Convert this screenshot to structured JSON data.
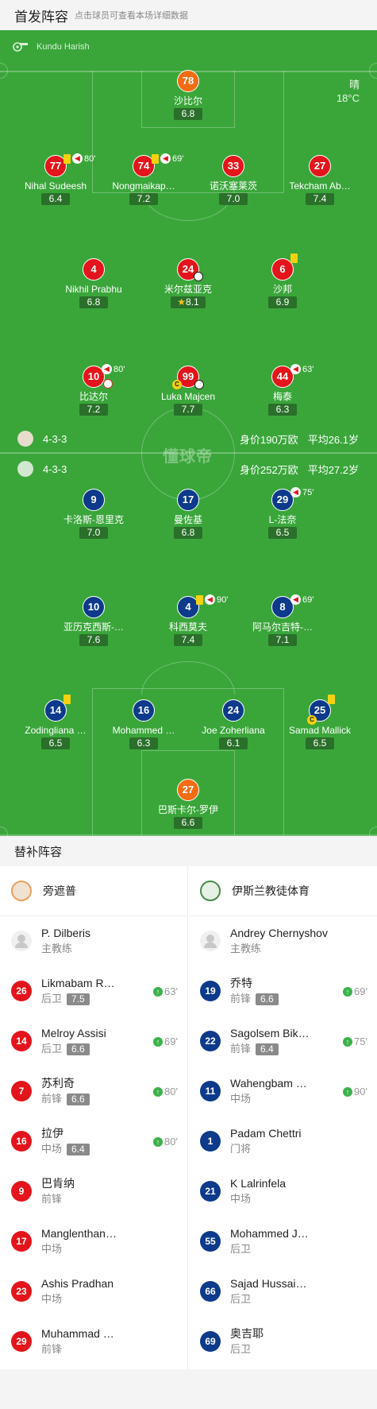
{
  "header": {
    "title": "首发阵容",
    "subtitle": "点击球员可查看本场详细数据"
  },
  "referee": {
    "name": "Kundu Harish",
    "icon": "whistle-icon"
  },
  "weather": {
    "condition": "晴",
    "temperature": "18°C"
  },
  "watermark": "懂球帝",
  "home_team": {
    "formation": "4-3-3",
    "value": "身价190万欧",
    "avg_age": "平均26.1岁"
  },
  "away_team": {
    "formation": "4-3-3",
    "value": "身价252万欧",
    "avg_age": "平均27.2岁"
  },
  "home_players": [
    {
      "num": "78",
      "name": "沙比尔",
      "rating": "6.8"
    },
    {
      "num": "77",
      "name": "Nihal Sudeesh",
      "rating": "6.4",
      "min": "80'"
    },
    {
      "num": "74",
      "name": "Nongmaikap…",
      "rating": "7.2",
      "min": "69'"
    },
    {
      "num": "33",
      "name": "诺沃塞莱茨",
      "rating": "7.0"
    },
    {
      "num": "27",
      "name": "Tekcham Ab…",
      "rating": "7.4"
    },
    {
      "num": "4",
      "name": "Nikhil Prabhu",
      "rating": "6.8"
    },
    {
      "num": "24",
      "name": "米尔兹亚克",
      "rating": "8.1"
    },
    {
      "num": "6",
      "name": "沙邦",
      "rating": "6.9"
    },
    {
      "num": "10",
      "name": "比达尔",
      "rating": "7.2",
      "min": "80'"
    },
    {
      "num": "99",
      "name": "Luka Majcen",
      "rating": "7.7"
    },
    {
      "num": "44",
      "name": "梅泰",
      "rating": "6.3",
      "min": "63'"
    }
  ],
  "away_players": [
    {
      "num": "9",
      "name": "卡洛斯-恩里克",
      "rating": "7.0"
    },
    {
      "num": "17",
      "name": "曼佐基",
      "rating": "6.8"
    },
    {
      "num": "29",
      "name": "L-法奈",
      "rating": "6.5",
      "min": "75'"
    },
    {
      "num": "10",
      "name": "亚历克西斯-…",
      "rating": "7.6"
    },
    {
      "num": "4",
      "name": "科西莫夫",
      "rating": "7.4",
      "min": "90'"
    },
    {
      "num": "8",
      "name": "阿马尔吉特-…",
      "rating": "7.1",
      "min": "69'"
    },
    {
      "num": "14",
      "name": "Zodingliana …",
      "rating": "6.5"
    },
    {
      "num": "16",
      "name": "Mohammed …",
      "rating": "6.3"
    },
    {
      "num": "24",
      "name": "Joe Zoherliana",
      "rating": "6.1"
    },
    {
      "num": "25",
      "name": "Samad Mallick",
      "rating": "6.5"
    },
    {
      "num": "27",
      "name": "巴斯卡尔-罗伊",
      "rating": "6.6"
    }
  ],
  "captain_badge": "C",
  "subs": {
    "title": "替补阵容",
    "home": {
      "team": "旁遮普",
      "coach": {
        "name": "P. Dilberis",
        "role": "主教练"
      },
      "players": [
        {
          "num": "26",
          "name": "Likmabam R…",
          "pos": "后卫",
          "rating": "7.5",
          "min": "63'"
        },
        {
          "num": "14",
          "name": "Melroy Assisi",
          "pos": "后卫",
          "rating": "6.6",
          "min": "69'"
        },
        {
          "num": "7",
          "name": "苏利奇",
          "pos": "前锋",
          "rating": "6.6",
          "min": "80'"
        },
        {
          "num": "16",
          "name": "拉伊",
          "pos": "中场",
          "rating": "6.4",
          "min": "80'"
        },
        {
          "num": "9",
          "name": "巴肯纳",
          "pos": "前锋"
        },
        {
          "num": "17",
          "name": "Manglenthan…",
          "pos": "中场"
        },
        {
          "num": "23",
          "name": "Ashis Pradhan",
          "pos": "中场"
        },
        {
          "num": "29",
          "name": "Muhammad …",
          "pos": "前锋"
        }
      ]
    },
    "away": {
      "team": "伊斯兰教徒体育",
      "coach": {
        "name": "Andrey Chernyshov",
        "role": "主教练"
      },
      "players": [
        {
          "num": "19",
          "name": "乔特",
          "pos": "前锋",
          "rating": "6.6",
          "min": "69'"
        },
        {
          "num": "22",
          "name": "Sagolsem Bik…",
          "pos": "前锋",
          "rating": "6.4",
          "min": "75'"
        },
        {
          "num": "11",
          "name": "Wahengbam …",
          "pos": "中场",
          "min": "90'"
        },
        {
          "num": "1",
          "name": "Padam Chettri",
          "pos": "门将"
        },
        {
          "num": "21",
          "name": "K Lalrinfela",
          "pos": "中场"
        },
        {
          "num": "55",
          "name": "Mohammed J…",
          "pos": "后卫"
        },
        {
          "num": "66",
          "name": "Sajad Hussai…",
          "pos": "后卫"
        },
        {
          "num": "69",
          "name": "奥吉耶",
          "pos": "后卫"
        }
      ]
    }
  }
}
